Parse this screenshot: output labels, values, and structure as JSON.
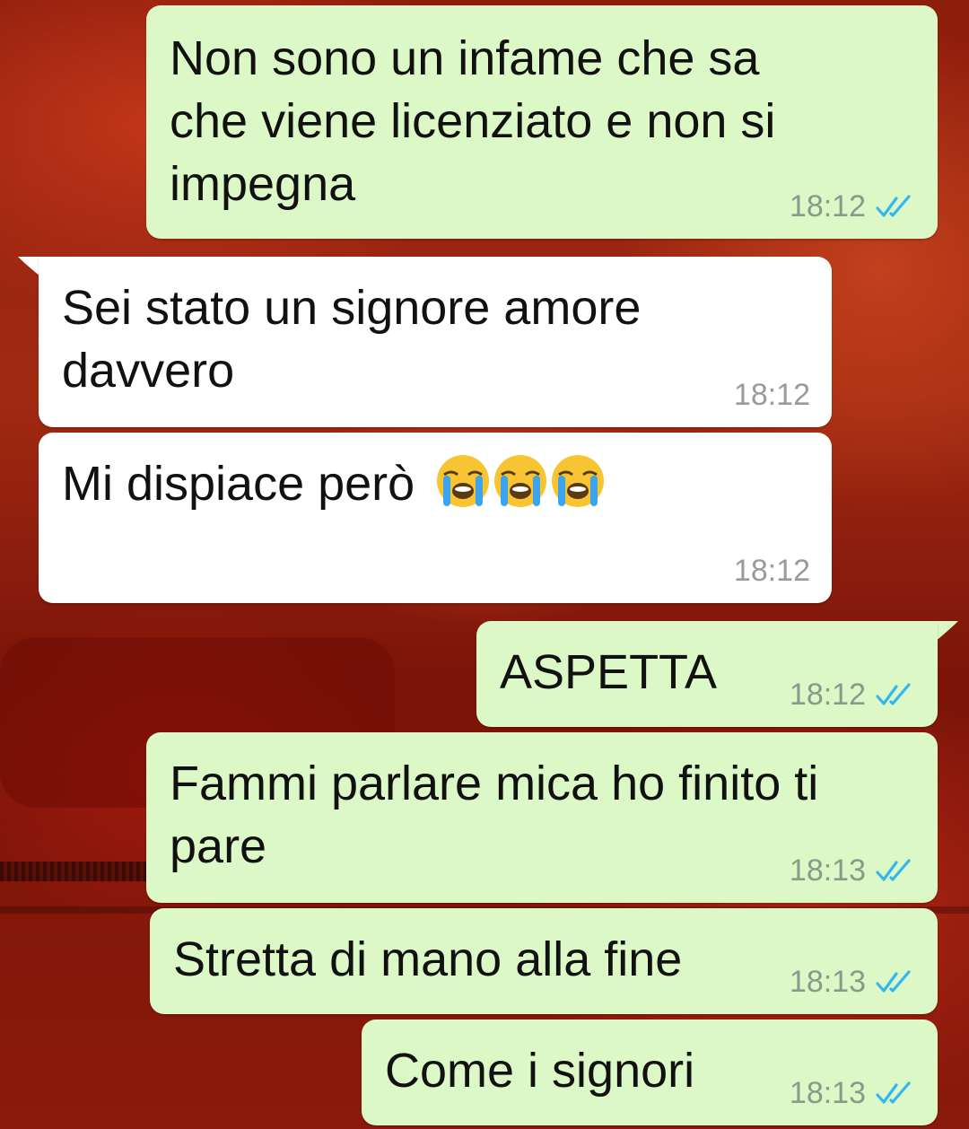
{
  "chat": {
    "messages": [
      {
        "direction": "outgoing",
        "text": "Non sono un infame che sa\nche viene licenziato e non si\nimpegna",
        "time": "18:12",
        "status": "read"
      },
      {
        "direction": "incoming",
        "text": "Sei stato un signore amore\ndavvero",
        "time": "18:12"
      },
      {
        "direction": "incoming",
        "text": "Mi dispiace però",
        "emoji": "loudly-crying-face-icon",
        "emoji_count": 3,
        "time": "18:12"
      },
      {
        "direction": "outgoing",
        "text": "ASPETTA",
        "time": "18:12",
        "status": "read"
      },
      {
        "direction": "outgoing",
        "text": "Fammi parlare mica ho finito ti\npare",
        "time": "18:13",
        "status": "read"
      },
      {
        "direction": "outgoing",
        "text": "Stretta di mano alla fine",
        "time": "18:13",
        "status": "read"
      },
      {
        "direction": "outgoing",
        "text": "Come i signori",
        "time": "18:13",
        "status": "read"
      }
    ]
  },
  "colors": {
    "outgoing_bubble": "#dcf8c6",
    "incoming_bubble": "#ffffff",
    "read_ticks": "#34b7f1",
    "wallpaper": "#9c2412"
  }
}
